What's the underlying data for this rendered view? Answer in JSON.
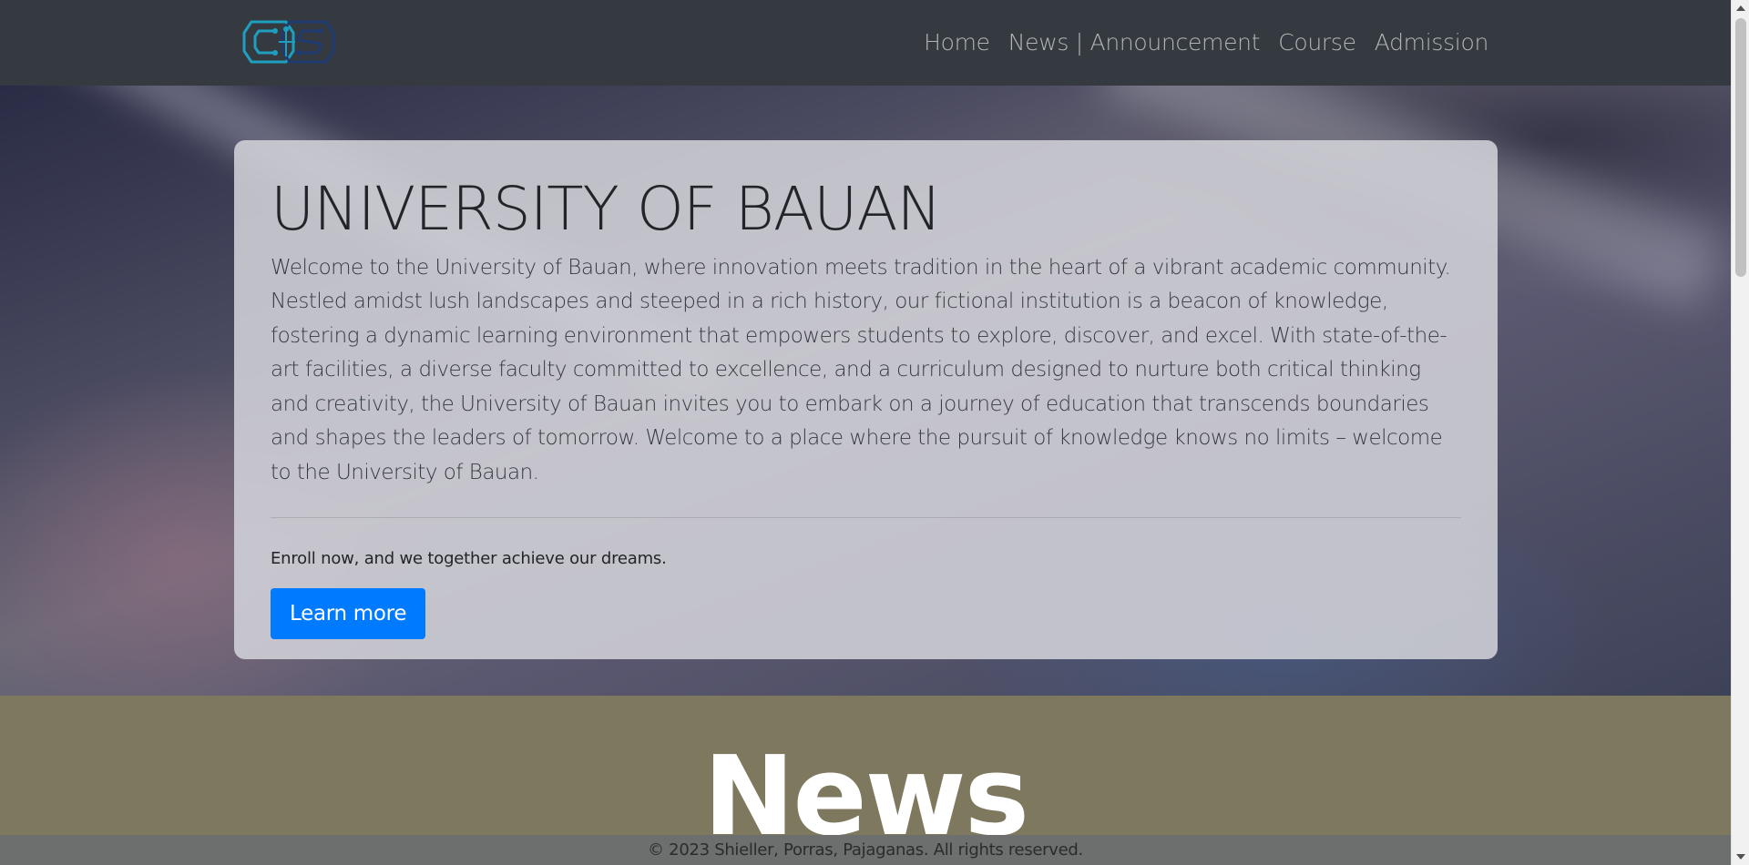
{
  "nav": {
    "logo_icon": "circuit-logo-icon",
    "links": [
      "Home",
      "News | Announcement",
      "Course",
      "Admission"
    ]
  },
  "hero": {
    "title": "UNIVERSITY OF BAUAN",
    "lead": "Welcome to the University of Bauan, where innovation meets tradition in the heart of a vibrant academic community. Nestled amidst lush landscapes and steeped in a rich history, our fictional institution is a beacon of knowledge, fostering a dynamic learning environment that empowers students to explore, discover, and excel. With state-of-the-art facilities, a diverse faculty committed to excellence, and a curriculum designed to nurture both critical thinking and creativity, the University of Bauan invites you to embark on a journey of education that transcends boundaries and shapes the leaders of tomorrow. Welcome to a place where the pursuit of knowledge knows no limits – welcome to the University of Bauan.",
    "subtext": "Enroll now, and we together achieve our dreams.",
    "button_label": "Learn more"
  },
  "news": {
    "heading": "News"
  },
  "footer": {
    "text": "© 2023 Shieller, Porras, Pajaganas. All rights reserved."
  },
  "colors": {
    "navbar": "#343a40",
    "primary": "#007bff",
    "news_bg": "#7d785e"
  }
}
